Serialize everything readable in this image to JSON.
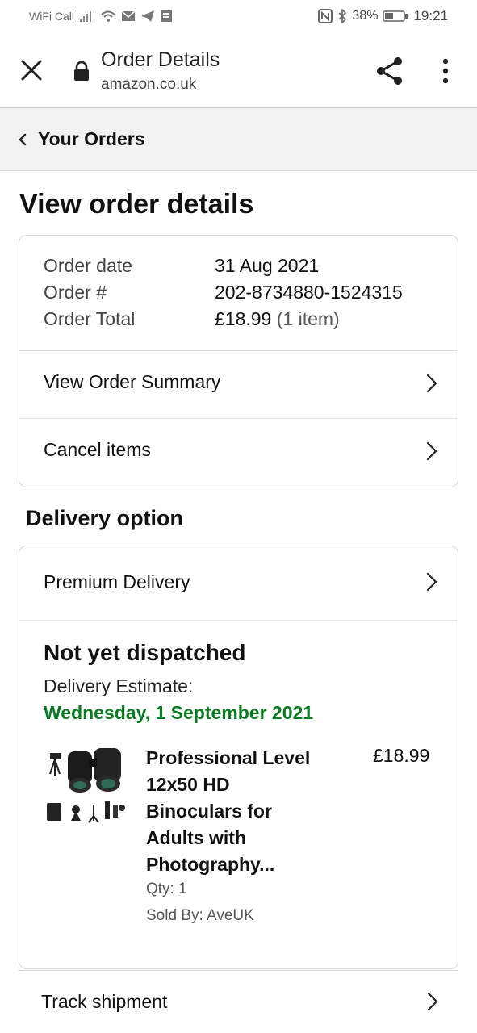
{
  "status_bar": {
    "carrier": "WiFi Call",
    "battery": "38%",
    "time": "19:21"
  },
  "browser": {
    "page_title": "Order Details",
    "url": "amazon.co.uk"
  },
  "breadcrumb": {
    "back_label": "Your Orders"
  },
  "page": {
    "heading": "View order details"
  },
  "order_info": {
    "rows": [
      {
        "label": "Order date",
        "value": "31 Aug 2021"
      },
      {
        "label": "Order #",
        "value": "202-8734880-1524315"
      },
      {
        "label": "Order Total",
        "value": "£18.99",
        "extra": "(1 item)"
      }
    ],
    "links": [
      {
        "label": "View Order Summary"
      },
      {
        "label": "Cancel items"
      }
    ]
  },
  "delivery": {
    "section_title": "Delivery option",
    "option": "Premium Delivery",
    "status": "Not yet dispatched",
    "estimate_label": "Delivery Estimate:",
    "estimate_date": "Wednesday, 1 September 2021",
    "accent_color": "#067d1e",
    "item": {
      "title_lines": [
        "Professional Level",
        "12x50 HD",
        "Binoculars for",
        "Adults with",
        "Photography..."
      ],
      "price": "£18.99",
      "qty": "Qty: 1",
      "sold_by": "Sold By: AveUK"
    }
  },
  "track": {
    "label": "Track shipment"
  },
  "icons": {
    "close": "close-icon",
    "lock": "lock-icon",
    "share": "share-icon",
    "menu": "more-vert-icon",
    "chevron_left": "chevron-left-icon",
    "chevron_right": "chevron-right-icon"
  }
}
